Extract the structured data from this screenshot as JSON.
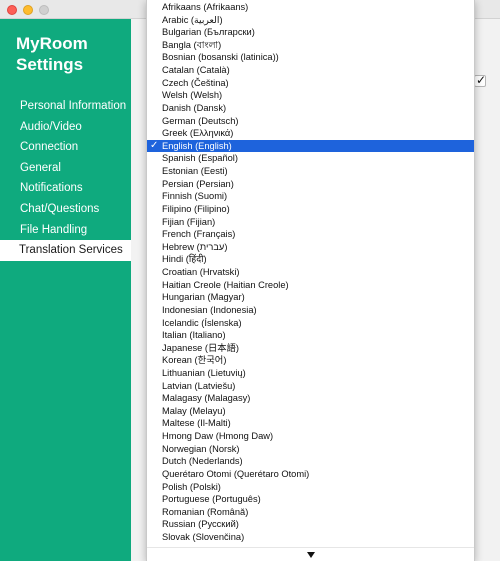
{
  "sidebar": {
    "title": "MyRoom Settings",
    "items": [
      {
        "label": "Personal Information"
      },
      {
        "label": "Audio/Video"
      },
      {
        "label": "Connection"
      },
      {
        "label": "General"
      },
      {
        "label": "Notifications"
      },
      {
        "label": "Chat/Questions"
      },
      {
        "label": "File Handling"
      },
      {
        "label": "Translation Services",
        "active": true
      }
    ]
  },
  "content": {
    "checkbox_checked": true
  },
  "language_dropdown": {
    "selected": "English (English)",
    "check_glyph": "✓",
    "options": [
      "Afrikaans (Afrikaans)",
      "Arabic (العربية)",
      "Bulgarian (Български)",
      "Bangla (বাংলা)",
      "Bosnian (bosanski (latinica))",
      "Catalan (Català)",
      "Czech (Čeština)",
      "Welsh (Welsh)",
      "Danish (Dansk)",
      "German (Deutsch)",
      "Greek (Ελληνικά)",
      "English (English)",
      "Spanish (Español)",
      "Estonian (Eesti)",
      "Persian (Persian)",
      "Finnish (Suomi)",
      "Filipino (Filipino)",
      "Fijian (Fijian)",
      "French (Français)",
      "Hebrew (עברית)",
      "Hindi (हिंदी)",
      "Croatian (Hrvatski)",
      "Haitian Creole (Haitian Creole)",
      "Hungarian (Magyar)",
      "Indonesian (Indonesia)",
      "Icelandic (Íslenska)",
      "Italian (Italiano)",
      "Japanese (日本語)",
      "Korean (한국어)",
      "Lithuanian (Lietuvių)",
      "Latvian (Latviešu)",
      "Malagasy (Malagasy)",
      "Malay (Melayu)",
      "Maltese (Il-Malti)",
      "Hmong Daw (Hmong Daw)",
      "Norwegian (Norsk)",
      "Dutch (Nederlands)",
      "Querétaro Otomi (Querétaro Otomi)",
      "Polish (Polski)",
      "Portuguese (Português)",
      "Romanian (Română)",
      "Russian (Русский)",
      "Slovak (Slovenčina)"
    ],
    "scroll_icon": "triangle-down-icon"
  },
  "colors": {
    "sidebar_green": "#0faa7e",
    "selection_blue": "#1e63dc"
  }
}
